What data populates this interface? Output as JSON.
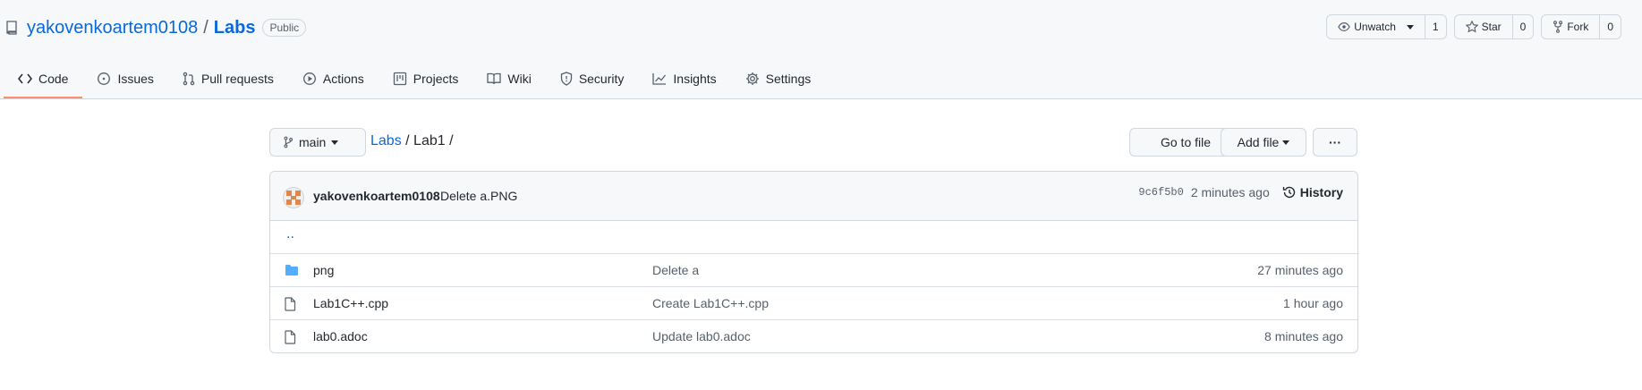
{
  "repo": {
    "owner": "yakovenkoartem0108",
    "separator": "/",
    "name": "Labs",
    "visibility": "Public"
  },
  "actions": {
    "watch": {
      "label": "Unwatch",
      "count": "1"
    },
    "star": {
      "label": "Star",
      "count": "0"
    },
    "fork": {
      "label": "Fork",
      "count": "0"
    }
  },
  "tabs": [
    {
      "label": "Code",
      "icon": "code-icon",
      "active": true
    },
    {
      "label": "Issues",
      "icon": "issue-icon"
    },
    {
      "label": "Pull requests",
      "icon": "pull-request-icon"
    },
    {
      "label": "Actions",
      "icon": "play-icon"
    },
    {
      "label": "Projects",
      "icon": "project-icon"
    },
    {
      "label": "Wiki",
      "icon": "book-icon"
    },
    {
      "label": "Security",
      "icon": "shield-icon"
    },
    {
      "label": "Insights",
      "icon": "graph-icon"
    },
    {
      "label": "Settings",
      "icon": "gear-icon"
    }
  ],
  "toolbar": {
    "branch": "main",
    "path_repo": "Labs",
    "path_rest": " / Lab1 /",
    "go_to_file": "Go to file",
    "add_file": "Add file",
    "more": "···"
  },
  "commit": {
    "author": "yakovenkoartem0108",
    "message": "Delete a.PNG",
    "sha": "9c6f5b0",
    "time": "2 minutes ago",
    "history": "History"
  },
  "files": {
    "parent": "..",
    "rows": [
      {
        "type": "folder",
        "name": "png",
        "message": "Delete a",
        "age": "27 minutes ago"
      },
      {
        "type": "file",
        "name": "Lab1C++.cpp",
        "message": "Create Lab1C++.cpp",
        "age": "1 hour ago"
      },
      {
        "type": "file",
        "name": "lab0.adoc",
        "message": "Update lab0.adoc",
        "age": "8 minutes ago"
      }
    ]
  },
  "colors": {
    "link": "#0969da",
    "active_tab_underline": "#fd8c73",
    "folder": "#54aeff"
  }
}
